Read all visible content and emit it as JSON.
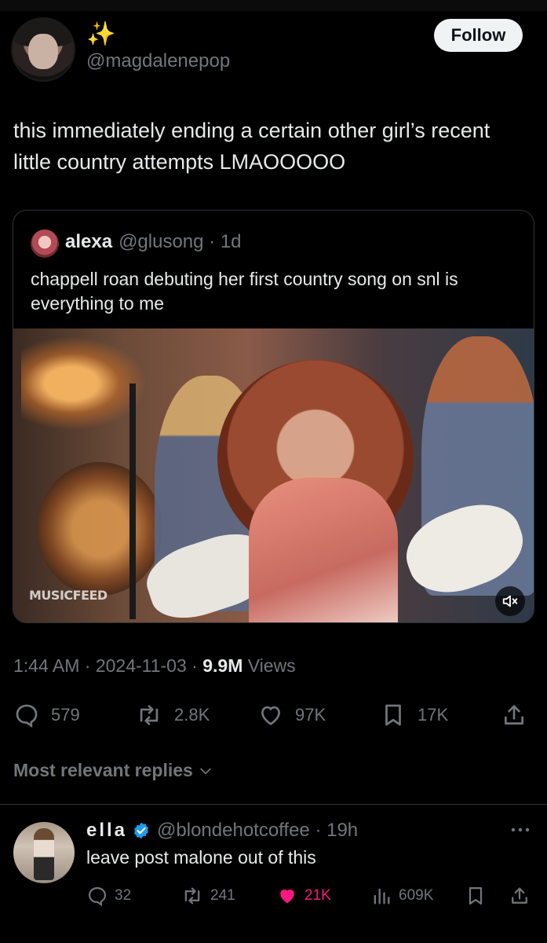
{
  "post": {
    "display_name": "✨",
    "handle": "@magdalenepop",
    "follow_label": "Follow",
    "text": "this immediately ending a certain other girl’s recent little country attempts LMAOOOOO",
    "timestamp": "1:44 AM · 2024-11-03 · ",
    "views_count": "9.9M",
    "views_label": " Views",
    "stats": {
      "replies": "579",
      "reposts": "2.8K",
      "likes": "97K",
      "bookmarks": "17K"
    }
  },
  "quote": {
    "name": "alexa",
    "handle": "@glusong · 1d",
    "text": "chappell roan debuting her first country song on snl is everything to me",
    "video_watermark": "MUSICFEED"
  },
  "replies_section": {
    "sort_label": "Most relevant replies"
  },
  "reply": {
    "name": "ella",
    "handle": "@blondehotcoffee · 19h",
    "text": "leave post malone out of this",
    "stats": {
      "replies": "32",
      "reposts": "241",
      "likes": "21K",
      "views": "609K"
    }
  },
  "colors": {
    "background": "#000000",
    "text_primary": "#e7e9ea",
    "text_secondary": "#71767b",
    "like_active": "#f91880",
    "verified": "#1d9bf0"
  },
  "icons": [
    "reply-icon",
    "repost-icon",
    "like-icon",
    "bookmark-icon",
    "share-icon",
    "views-icon",
    "mute-icon",
    "verified-icon",
    "chevron-down-icon",
    "more-icon"
  ]
}
